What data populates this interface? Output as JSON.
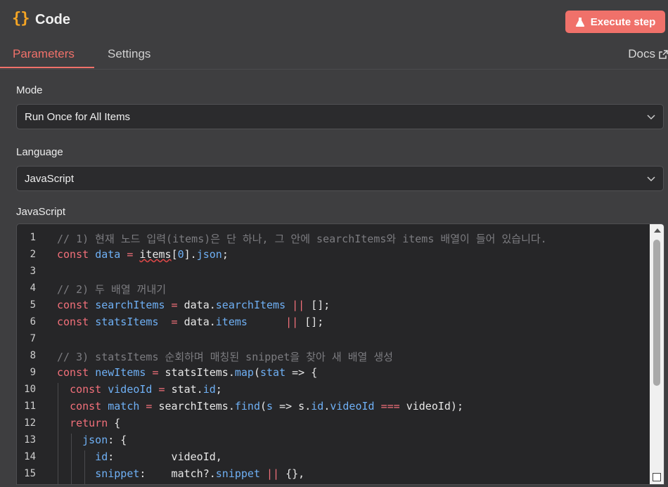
{
  "header": {
    "title": "Code",
    "execute_label": "Execute step"
  },
  "tabs": {
    "parameters": "Parameters",
    "settings": "Settings",
    "docs": "Docs"
  },
  "mode": {
    "label": "Mode",
    "value": "Run Once for All Items"
  },
  "language": {
    "label": "Language",
    "value": "JavaScript"
  },
  "editor": {
    "label": "JavaScript",
    "lines": [
      [
        {
          "t": "// 1) 현재 노드 입력(items)은 단 하나, 그 안에 searchItems와 items 배열이 들어 있습니다.",
          "c": "cm"
        }
      ],
      [
        {
          "t": "const",
          "c": "kw"
        },
        {
          "t": " ",
          "c": "pl"
        },
        {
          "t": "data",
          "c": "var"
        },
        {
          "t": " = ",
          "c": "op"
        },
        {
          "t": "items",
          "c": "sq"
        },
        {
          "t": "[",
          "c": "pl"
        },
        {
          "t": "0",
          "c": "num"
        },
        {
          "t": "].",
          "c": "pl"
        },
        {
          "t": "json",
          "c": "var"
        },
        {
          "t": ";",
          "c": "pl"
        }
      ],
      [],
      [
        {
          "t": "// 2) 두 배열 꺼내기",
          "c": "cm"
        }
      ],
      [
        {
          "t": "const",
          "c": "kw"
        },
        {
          "t": " ",
          "c": "pl"
        },
        {
          "t": "searchItems",
          "c": "var"
        },
        {
          "t": " = ",
          "c": "op"
        },
        {
          "t": "data.",
          "c": "pl"
        },
        {
          "t": "searchItems",
          "c": "var"
        },
        {
          "t": " || ",
          "c": "op"
        },
        {
          "t": "[];",
          "c": "pl"
        }
      ],
      [
        {
          "t": "const",
          "c": "kw"
        },
        {
          "t": " ",
          "c": "pl"
        },
        {
          "t": "statsItems",
          "c": "var"
        },
        {
          "t": "  = ",
          "c": "op"
        },
        {
          "t": "data.",
          "c": "pl"
        },
        {
          "t": "items",
          "c": "var"
        },
        {
          "t": "      || ",
          "c": "op"
        },
        {
          "t": "[];",
          "c": "pl"
        }
      ],
      [],
      [
        {
          "t": "// 3) statsItems 순회하며 매칭된 snippet을 찾아 새 배열 생성",
          "c": "cm"
        }
      ],
      [
        {
          "t": "const",
          "c": "kw"
        },
        {
          "t": " ",
          "c": "pl"
        },
        {
          "t": "newItems",
          "c": "var"
        },
        {
          "t": " = ",
          "c": "op"
        },
        {
          "t": "statsItems.",
          "c": "pl"
        },
        {
          "t": "map",
          "c": "var"
        },
        {
          "t": "(",
          "c": "pl"
        },
        {
          "t": "stat",
          "c": "var"
        },
        {
          "t": " => {",
          "c": "pl"
        }
      ],
      [
        {
          "t": "  ",
          "c": "pl"
        },
        {
          "t": "const",
          "c": "kw"
        },
        {
          "t": " ",
          "c": "pl"
        },
        {
          "t": "videoId",
          "c": "var"
        },
        {
          "t": " = ",
          "c": "op"
        },
        {
          "t": "stat.",
          "c": "pl"
        },
        {
          "t": "id",
          "c": "var"
        },
        {
          "t": ";",
          "c": "pl"
        }
      ],
      [
        {
          "t": "  ",
          "c": "pl"
        },
        {
          "t": "const",
          "c": "kw"
        },
        {
          "t": " ",
          "c": "pl"
        },
        {
          "t": "match",
          "c": "var"
        },
        {
          "t": " = ",
          "c": "op"
        },
        {
          "t": "searchItems.",
          "c": "pl"
        },
        {
          "t": "find",
          "c": "var"
        },
        {
          "t": "(",
          "c": "pl"
        },
        {
          "t": "s",
          "c": "var"
        },
        {
          "t": " => s.",
          "c": "pl"
        },
        {
          "t": "id",
          "c": "var"
        },
        {
          "t": ".",
          "c": "pl"
        },
        {
          "t": "videoId",
          "c": "var"
        },
        {
          "t": " === ",
          "c": "op"
        },
        {
          "t": "videoId);",
          "c": "pl"
        }
      ],
      [
        {
          "t": "  ",
          "c": "pl"
        },
        {
          "t": "return",
          "c": "kw"
        },
        {
          "t": " {",
          "c": "pl"
        }
      ],
      [
        {
          "t": "    ",
          "c": "pl"
        },
        {
          "t": "json",
          "c": "var"
        },
        {
          "t": ": {",
          "c": "pl"
        }
      ],
      [
        {
          "t": "      ",
          "c": "pl"
        },
        {
          "t": "id",
          "c": "var"
        },
        {
          "t": ":         videoId,",
          "c": "pl"
        }
      ],
      [
        {
          "t": "      ",
          "c": "pl"
        },
        {
          "t": "snippet",
          "c": "var"
        },
        {
          "t": ":    match?.",
          "c": "pl"
        },
        {
          "t": "snippet",
          "c": "var"
        },
        {
          "t": " || ",
          "c": "op"
        },
        {
          "t": "{},",
          "c": "pl"
        }
      ]
    ]
  },
  "colors": {
    "accent": "#f0716a",
    "keyword": "#f2707a",
    "identifier": "#6fb0f5",
    "comment": "#7c7c80",
    "brace": "#f5a524"
  }
}
